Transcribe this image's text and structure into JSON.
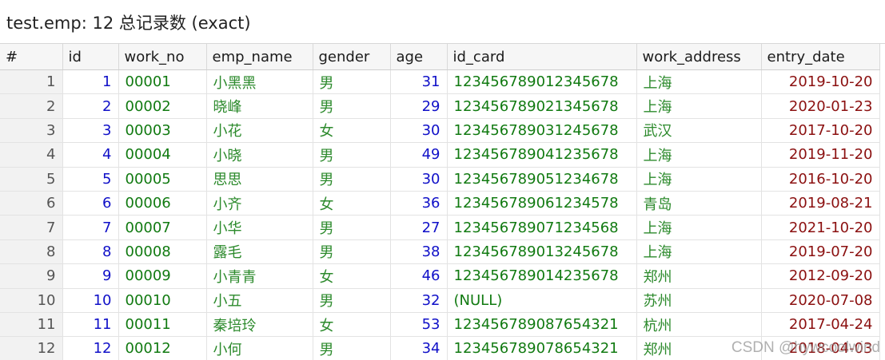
{
  "title": "test.emp: 12 总记录数 (exact)",
  "columns": [
    "#",
    "id",
    "work_no",
    "emp_name",
    "gender",
    "age",
    "id_card",
    "work_address",
    "entry_date"
  ],
  "rows": [
    [
      "1",
      "1",
      "00001",
      "小黑黑",
      "男",
      "31",
      "123456789012345678",
      "上海",
      "2019-10-20"
    ],
    [
      "2",
      "2",
      "00002",
      "晓峰",
      "男",
      "29",
      "123456789021345678",
      "上海",
      "2020-01-23"
    ],
    [
      "3",
      "3",
      "00003",
      "小花",
      "女",
      "30",
      "123456789031245678",
      "武汉",
      "2017-10-20"
    ],
    [
      "4",
      "4",
      "00004",
      "小晓",
      "男",
      "49",
      "123456789041235678",
      "上海",
      "2019-11-20"
    ],
    [
      "5",
      "5",
      "00005",
      "思思",
      "男",
      "30",
      "123456789051234678",
      "上海",
      "2016-10-20"
    ],
    [
      "6",
      "6",
      "00006",
      "小齐",
      "女",
      "36",
      "123456789061234578",
      "青岛",
      "2019-08-21"
    ],
    [
      "7",
      "7",
      "00007",
      "小华",
      "男",
      "27",
      "123456789071234568",
      "上海",
      "2021-10-20"
    ],
    [
      "8",
      "8",
      "00008",
      "露毛",
      "男",
      "38",
      "123456789013245678",
      "上海",
      "2019-07-20"
    ],
    [
      "9",
      "9",
      "00009",
      "小青青",
      "女",
      "46",
      "123456789014235678",
      "郑州",
      "2012-09-20"
    ],
    [
      "10",
      "10",
      "00010",
      "小五",
      "男",
      "32",
      "(NULL)",
      "苏州",
      "2020-07-08"
    ],
    [
      "11",
      "11",
      "00011",
      "秦培玲",
      "女",
      "53",
      "123456789087654321",
      "杭州",
      "2017-04-24"
    ],
    [
      "12",
      "12",
      "00012",
      "小何",
      "男",
      "34",
      "123456789078654321",
      "郑州",
      "2018-04-03"
    ]
  ],
  "watermark": "CSDN @hywcoolwind"
}
